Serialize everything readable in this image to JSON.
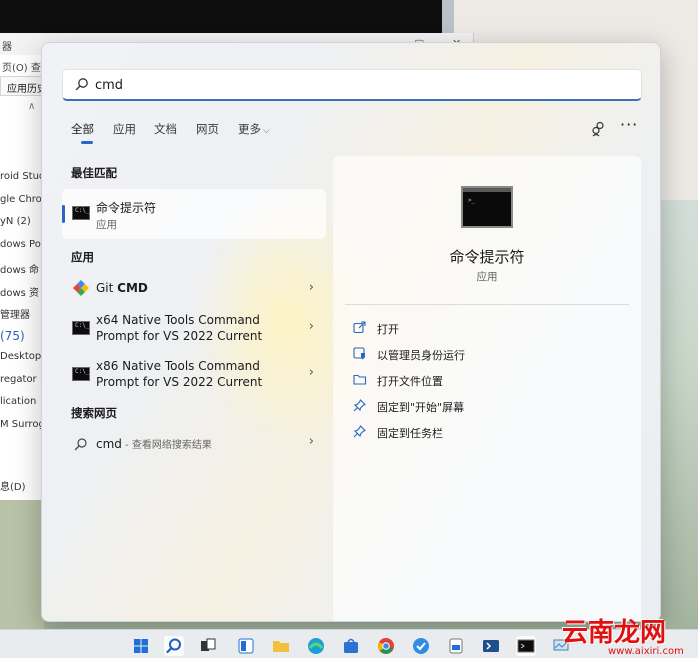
{
  "background_window": {
    "title_fragment": "器",
    "menu_fragment": "页(O)  查",
    "tab_fragment": "应用历史",
    "list": [
      "roid Stud",
      "gle Chro",
      "yN (2)",
      "dows Po",
      "dows 命",
      "dows 资",
      "管理器",
      "(75)",
      "Desktop",
      "regator",
      "lication",
      "M Surrog"
    ],
    "footer_fragment": "息(D)"
  },
  "search": {
    "query": "cmd"
  },
  "tabs": [
    {
      "label": "全部"
    },
    {
      "label": "应用"
    },
    {
      "label": "文档"
    },
    {
      "label": "网页"
    },
    {
      "label": "更多"
    }
  ],
  "sections": {
    "best_match": "最佳匹配",
    "apps": "应用",
    "web": "搜索网页"
  },
  "best_match": {
    "title": "命令提示符",
    "subtitle": "应用"
  },
  "apps": [
    {
      "line1_prefix": "Git ",
      "line1_bold": "CMD",
      "line2": ""
    },
    {
      "line1_prefix": "x64 Native Tools Command",
      "line1_bold": "",
      "line2": "Prompt for VS 2022 Current"
    },
    {
      "line1_prefix": "x86 Native Tools Command",
      "line1_bold": "",
      "line2": "Prompt for VS 2022 Current"
    }
  ],
  "web_result": {
    "query": "cmd",
    "hint": " - 查看网络搜索结果"
  },
  "detail": {
    "title": "命令提示符",
    "subtitle": "应用",
    "actions": [
      {
        "label": "打开",
        "icon": "open-external-icon"
      },
      {
        "label": "以管理员身份运行",
        "icon": "run-as-admin-icon"
      },
      {
        "label": "打开文件位置",
        "icon": "folder-icon"
      },
      {
        "label": "固定到\"开始\"屏幕",
        "icon": "pin-icon"
      },
      {
        "label": "固定到任务栏",
        "icon": "pin-icon"
      }
    ]
  },
  "watermark": {
    "brand": "云南龙网",
    "url": "www.aixiri.com"
  },
  "colors": {
    "accent": "#2b66c2",
    "watermark": "#e01010"
  }
}
